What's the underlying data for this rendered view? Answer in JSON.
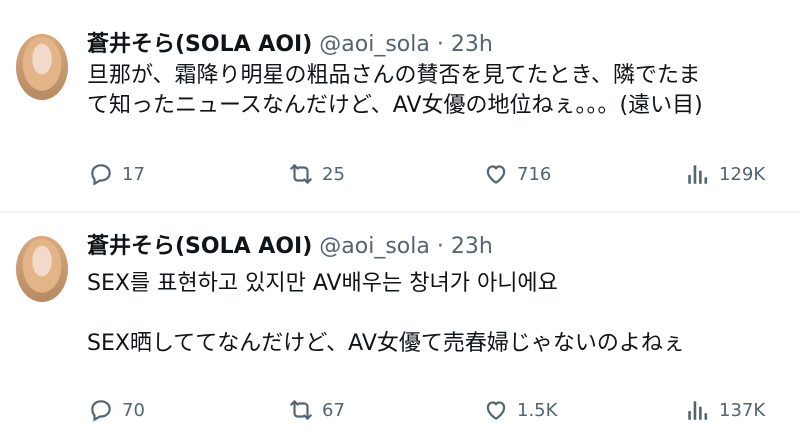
{
  "tweets": [
    {
      "author": {
        "name": "蒼井そら(SOLA AOI)",
        "handle": "@aoi_sola"
      },
      "separator": "·",
      "time": "23h",
      "lines": [
        "旦那が、霜降り明星の粗品さんの賛否を見てたとき、隣でたま",
        "て知ったニュースなんだけど、AV女優の地位ねぇ。。。(遠い目)"
      ],
      "actions": {
        "replies": "17",
        "reposts": "25",
        "likes": "716",
        "views": "129K"
      }
    },
    {
      "author": {
        "name": "蒼井そら(SOLA AOI)",
        "handle": "@aoi_sola"
      },
      "separator": "·",
      "time": "23h",
      "lines": [
        "SEX를 표현하고 있지만 AV배우는 창녀가 아니에요",
        "SEX晒しててなんだけど、AV女優て売春婦じゃないのよねぇ"
      ],
      "actions": {
        "replies": "70",
        "reposts": "67",
        "likes": "1.5K",
        "views": "137K"
      }
    }
  ],
  "icons": {
    "reply": "reply-icon",
    "repost": "repost-icon",
    "like": "like-icon",
    "views": "views-icon"
  },
  "colors": {
    "text": "#0f1419",
    "muted": "#536471",
    "divider": "#eff3f4"
  }
}
